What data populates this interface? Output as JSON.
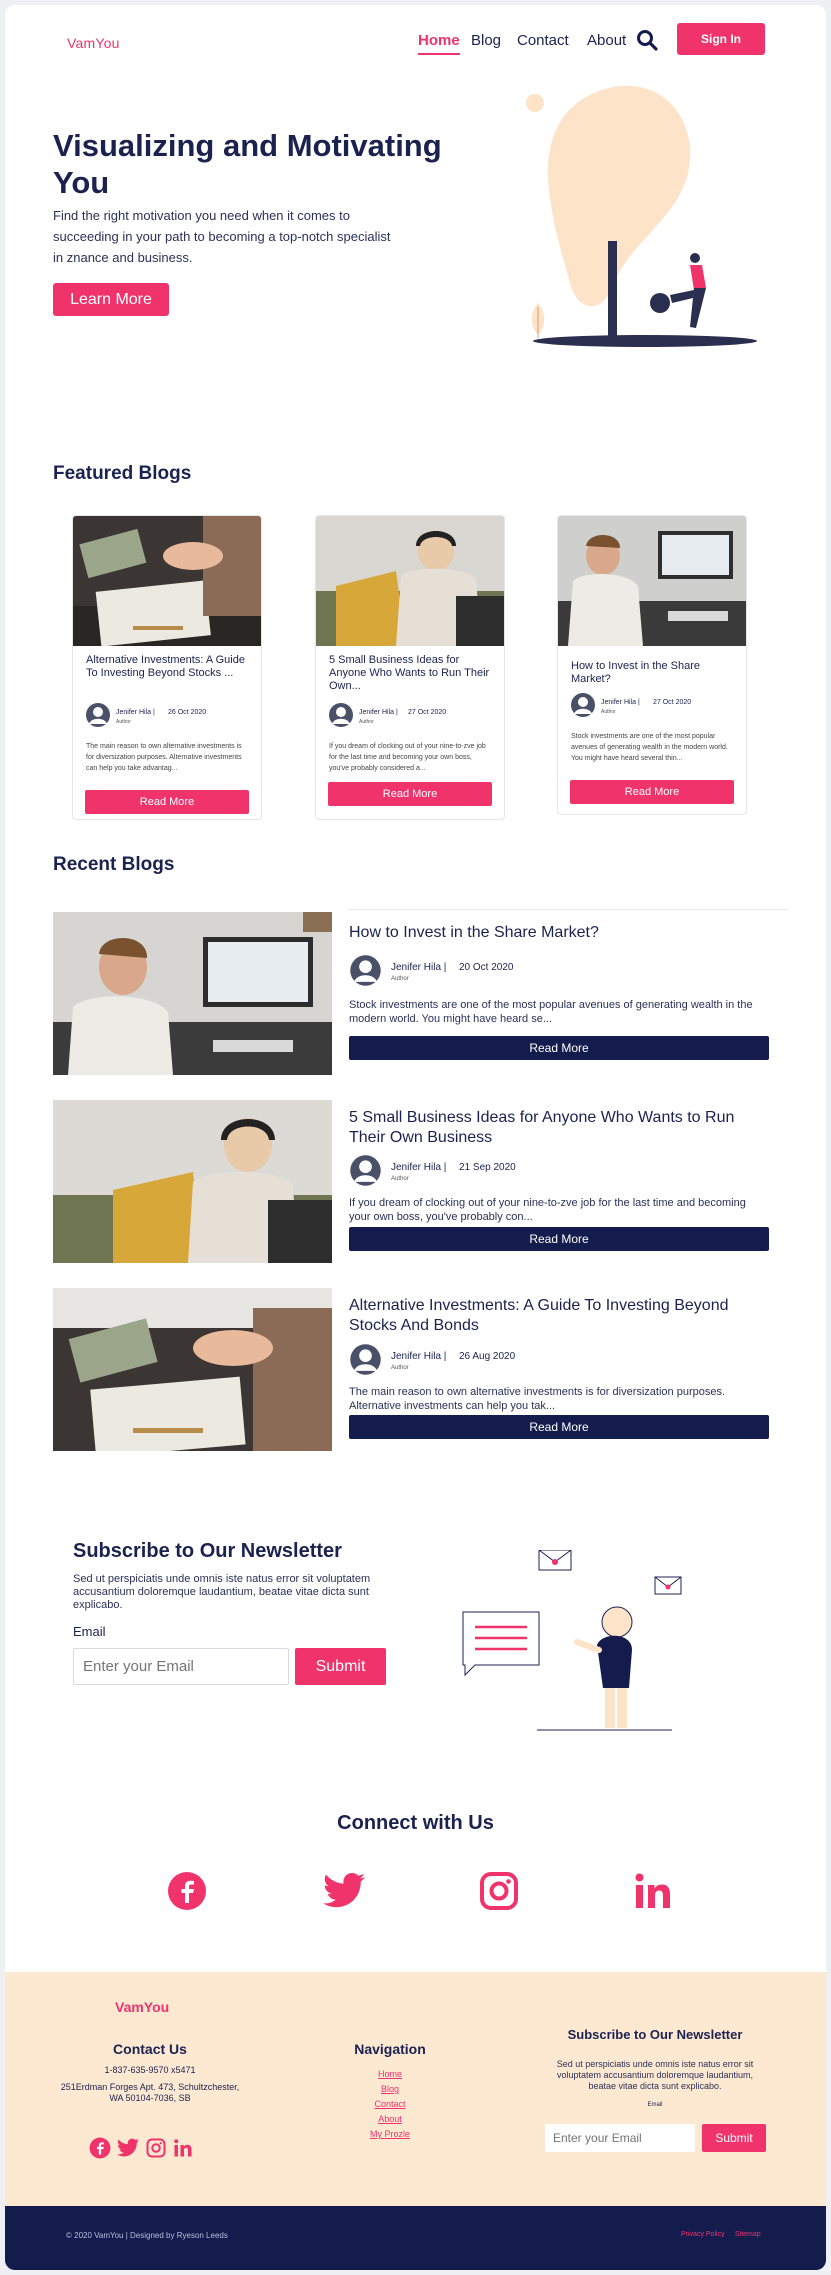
{
  "header": {
    "logo": "VamYou",
    "nav": [
      "Home",
      "Blog",
      "Contact",
      "About"
    ],
    "signin": "Sign In"
  },
  "hero": {
    "title": "Visualizing and Motivating You",
    "subtitle": "Find the right motivation you need when it comes to succeeding in your path to becoming a top-notch specialist in znance and business.",
    "cta": "Learn More"
  },
  "featured": {
    "title": "Featured Blogs",
    "cards": [
      {
        "title": "Alternative Investments: A Guide To Investing Beyond Stocks ...",
        "author": "Jenifer Hila |",
        "role": "Author",
        "date": "26 Oct 2020",
        "excerpt": "The main reason to own alternative investments is for diversization purposes. Alternative investments can help you take advantag...",
        "button": "Read More"
      },
      {
        "title": "5 Small Business Ideas for Anyone Who Wants to Run Their Own...",
        "author": "Jenifer Hila |",
        "role": "Author",
        "date": "27 Oct 2020",
        "excerpt": "If you dream of clocking out of your nine-to-zve job for the last time and becoming your own boss, you've probably considered a...",
        "button": "Read More"
      },
      {
        "title": "How to Invest in the Share Market?",
        "author": "Jenifer Hila |",
        "role": "Author",
        "date": "27 Oct 2020",
        "excerpt": "Stock investments are one of the most popular avenues of generating wealth in the modern world. You might have heard several thin...",
        "button": "Read More"
      }
    ]
  },
  "recent": {
    "title": "Recent Blogs",
    "items": [
      {
        "title": "How to Invest in the Share Market?",
        "author": "Jenifer Hila |",
        "role": "Author",
        "date": "20 Oct 2020",
        "excerpt": "Stock investments are one of the most popular avenues of generating wealth in the modern world. You might have heard se...",
        "button": "Read More"
      },
      {
        "title": "5 Small Business Ideas for Anyone Who Wants to Run Their Own Business",
        "author": "Jenifer Hila |",
        "role": "Author",
        "date": "21 Sep 2020",
        "excerpt": "If you dream of clocking out of your nine-to-zve job for the last time and becoming your own boss, you've probably con...",
        "button": "Read More"
      },
      {
        "title": "Alternative Investments: A Guide To Investing Beyond Stocks And Bonds",
        "author": "Jenifer Hila |",
        "role": "Author",
        "date": "26 Aug 2020",
        "excerpt": "The main reason to own alternative investments is for diversization purposes. Alternative investments can help you tak...",
        "button": "Read More"
      }
    ]
  },
  "newsletter": {
    "title": "Subscribe to Our Newsletter",
    "text": "Sed ut perspiciatis unde omnis iste natus error sit voluptatem accusantium doloremque laudantium, beatae vitae dicta sunt explicabo.",
    "label": "Email",
    "placeholder": "Enter your Email",
    "button": "Submit"
  },
  "connect": {
    "title": "Connect with Us",
    "icons": [
      "facebook-icon",
      "twitter-icon",
      "instagram-icon",
      "linkedin-icon"
    ]
  },
  "footer": {
    "logo": "VamYou",
    "contact_title": "Contact Us",
    "phone": "1-837-635-9570 x5471",
    "address": "251Erdman Forges Apt. 473, Schultzchester, WA 50104-7036, SB",
    "nav_title": "Navigation",
    "nav": [
      "Home",
      "Blog",
      "Contact",
      "About",
      "My Prozle"
    ],
    "nl_title": "Subscribe to Our Newsletter",
    "nl_text": "Sed ut perspiciatis unde omnis iste natus error sit voluptatem accusantium doloremque laudantium, beatae vitae dicta sunt explicabo.",
    "nl_label": "Email",
    "nl_placeholder": "Enter your Email",
    "nl_button": "Submit",
    "copyright": "© 2020 VamYou | Designed by Ryeson Leeds",
    "links": [
      "Privacy Policy",
      "Sitemap"
    ]
  },
  "colors": {
    "accent": "#f0336b",
    "navy": "#141c4d",
    "peach": "#fde8d2"
  }
}
